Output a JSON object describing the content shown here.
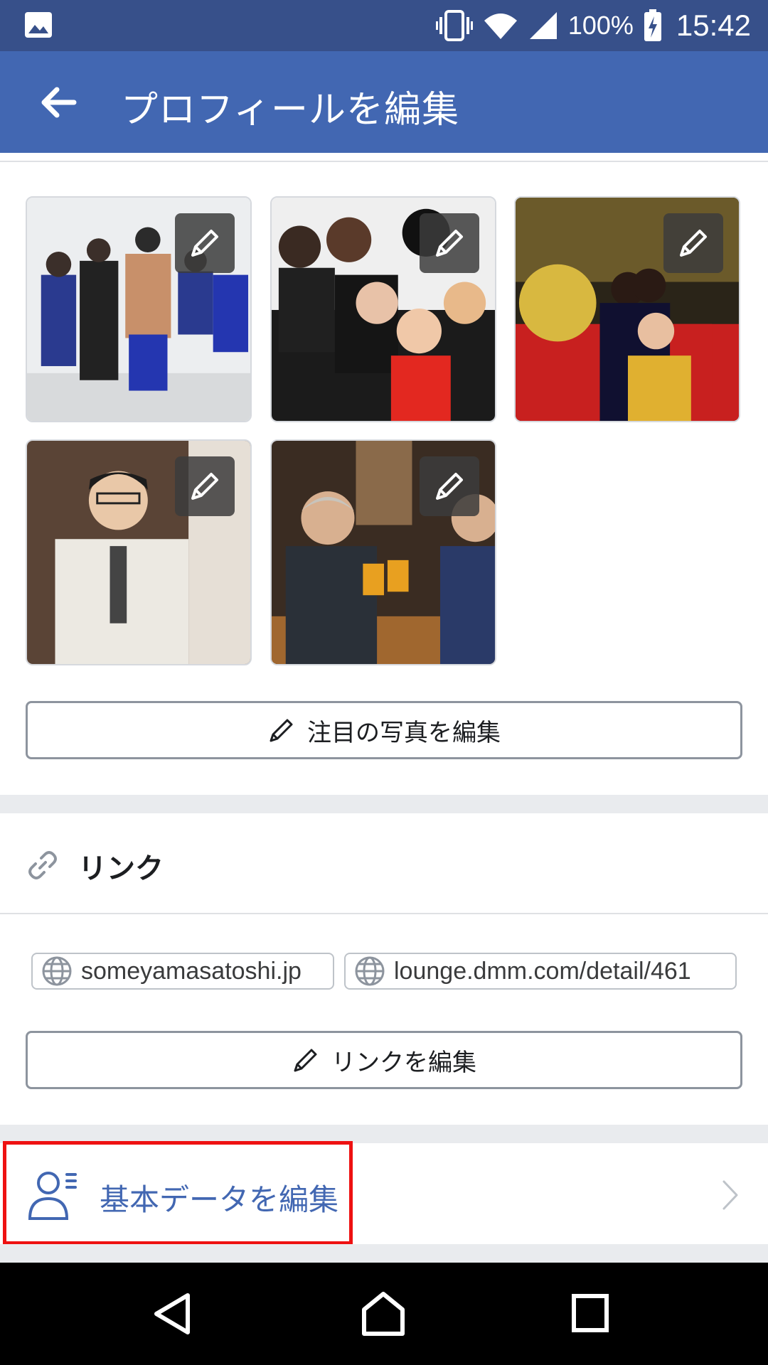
{
  "status_bar": {
    "gallery_icon": "image-icon",
    "battery_percent": "100%",
    "time": "15:42"
  },
  "app_bar": {
    "title": "プロフィールを編集",
    "back_icon": "arrow-left-icon",
    "color": "#4267b2"
  },
  "featured_photos": {
    "photos": [
      {
        "alt": "グループ写真 1"
      },
      {
        "alt": "グループ写真 2"
      },
      {
        "alt": "グループ写真 3"
      },
      {
        "alt": "ポートレート写真"
      },
      {
        "alt": "乾杯の写真"
      }
    ],
    "edit_button_label": "注目の写真を編集"
  },
  "links": {
    "header": "リンク",
    "items": [
      "someyamasatoshi.jp",
      "lounge.dmm.com/detail/461"
    ],
    "edit_button_label": "リンクを編集"
  },
  "basic_info": {
    "label": "基本データを編集",
    "highlight_color": "#ee1111"
  },
  "nav_bar": {
    "back": "nav-back-icon",
    "home": "nav-home-icon",
    "recents": "nav-recents-icon"
  }
}
